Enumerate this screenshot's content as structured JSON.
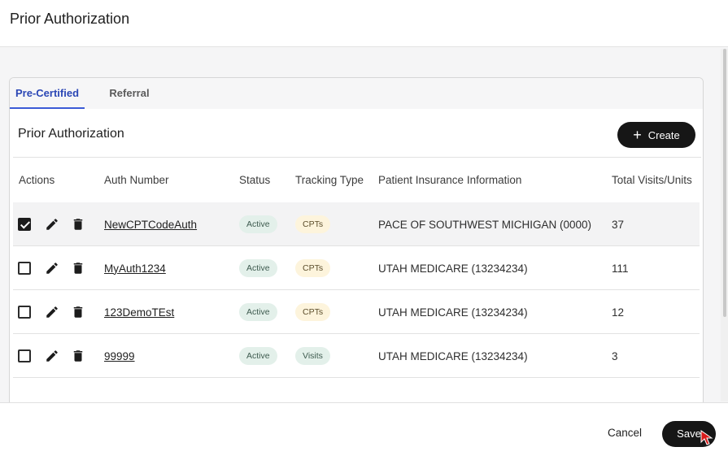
{
  "header": {
    "title": "Prior Authorization"
  },
  "tabs": [
    {
      "label": "Pre-Certified",
      "active": true
    },
    {
      "label": "Referral",
      "active": false
    }
  ],
  "section": {
    "title": "Prior Authorization",
    "create_label": "Create",
    "create_icon": "plus-icon"
  },
  "table": {
    "columns": [
      "Actions",
      "Auth Number",
      "Status",
      "Tracking Type",
      "Patient Insurance Information",
      "Total Visits/Units"
    ],
    "rows": [
      {
        "checked": true,
        "auth": "NewCPTCodeAuth",
        "status": "Active",
        "tracking": "CPTs",
        "insurance": "PACE OF SOUTHWEST MICHIGAN (0000)",
        "total": "37"
      },
      {
        "checked": false,
        "auth": "MyAuth1234",
        "status": "Active",
        "tracking": "CPTs",
        "insurance": "UTAH MEDICARE (13234234)",
        "total": "111"
      },
      {
        "checked": false,
        "auth": "123DemoTEst",
        "status": "Active",
        "tracking": "CPTs",
        "insurance": "UTAH MEDICARE (13234234)",
        "total": "12"
      },
      {
        "checked": false,
        "auth": "99999",
        "status": "Active",
        "tracking": "Visits",
        "insurance": "UTAH MEDICARE (13234234)",
        "total": "3"
      }
    ]
  },
  "footer": {
    "cancel_label": "Cancel",
    "save_label": "Save"
  },
  "colors": {
    "accent": "#2b47b5",
    "primary_button": "#161616",
    "status_pill": "#e3f0ea",
    "cpt_pill": "#fdf4dc"
  }
}
